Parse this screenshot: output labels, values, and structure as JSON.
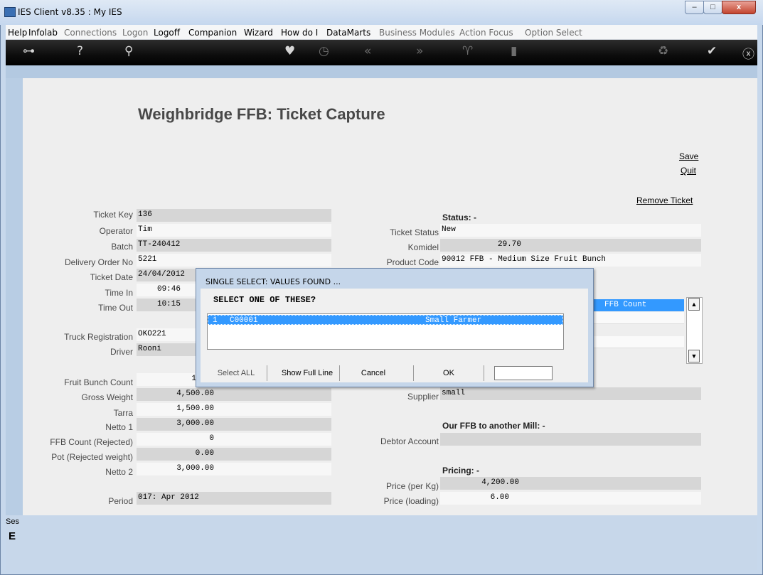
{
  "window": {
    "title": "IES Client v8.35 : My IES",
    "min": "–",
    "max": "□",
    "close": "x"
  },
  "menu": [
    {
      "label": "Help",
      "enabled": true
    },
    {
      "label": "Infolab",
      "enabled": true
    },
    {
      "label": "Connections",
      "enabled": false
    },
    {
      "label": "Logon",
      "enabled": false
    },
    {
      "label": "Logoff",
      "enabled": true
    },
    {
      "label": "Companion",
      "enabled": true
    },
    {
      "label": "Wizard",
      "enabled": true
    },
    {
      "label": "How do I",
      "enabled": true
    },
    {
      "label": "DataMarts",
      "enabled": true
    },
    {
      "label": "Business Modules",
      "enabled": false
    },
    {
      "label": "Action Focus",
      "enabled": false
    },
    {
      "label": "Option Select",
      "enabled": false
    }
  ],
  "toolbar": {
    "key": "⊶",
    "help": "?",
    "search": "⚲",
    "heart": "♥",
    "clock": "◷",
    "prev": "«",
    "next": "»",
    "tree": "♈",
    "doc": "▮",
    "recycle": "♻",
    "check": "✔",
    "close": "ⓧ"
  },
  "page": {
    "title": "Weighbridge FFB: Ticket Capture",
    "save": "Save",
    "quit": "Quit",
    "remove_ticket": "Remove Ticket"
  },
  "left": {
    "ticket_key": {
      "label": "Ticket Key",
      "value": "136"
    },
    "operator": {
      "label": "Operator",
      "value": "Tim"
    },
    "batch": {
      "label": "Batch",
      "value": "TT-240412"
    },
    "delivery_order": {
      "label": "Delivery Order No",
      "value": "5221"
    },
    "ticket_date": {
      "label": "Ticket Date",
      "value": "24/04/2012"
    },
    "time_in": {
      "label": "Time In",
      "value": "09:46"
    },
    "time_out": {
      "label": "Time Out",
      "value": "10:15"
    },
    "truck_reg": {
      "label": "Truck Registration",
      "value": "OKO221"
    },
    "driver": {
      "label": "Driver",
      "value": "Rooni"
    },
    "fruit_bunch_count": {
      "label": "Fruit Bunch Count",
      "value": "1"
    },
    "gross_weight": {
      "label": "Gross Weight",
      "value": "4,500.00"
    },
    "tarra": {
      "label": "Tarra",
      "value": "1,500.00"
    },
    "netto1": {
      "label": "Netto 1",
      "value": "3,000.00"
    },
    "ffb_rejected": {
      "label": "FFB Count (Rejected)",
      "value": "0"
    },
    "pot_rejected": {
      "label": "Pot (Rejected weight)",
      "value": "0.00"
    },
    "netto2": {
      "label": "Netto 2",
      "value": "3,000.00"
    },
    "period": {
      "label": "Period",
      "value": "017: Apr 2012"
    }
  },
  "right": {
    "status_heading": "Status: -",
    "ticket_status": {
      "label": "Ticket Status",
      "value": "New"
    },
    "komidel": {
      "label": "Komidel",
      "value": "29.70"
    },
    "product_code": {
      "label": "Product Code",
      "value": "90012 FFB - Medium Size Fruit Bunch"
    },
    "grid_header": "FFB Count",
    "supplier": {
      "label": "Supplier",
      "value": "small"
    },
    "mill_heading": "Our FFB to another Mill: -",
    "debtor_account": {
      "label": "Debtor Account",
      "value": ""
    },
    "pricing_heading": "Pricing: -",
    "price_kg": {
      "label": "Price (per Kg)",
      "value": "4,200.00"
    },
    "price_loading": {
      "label": "Price (loading)",
      "value": "6.00"
    }
  },
  "dialog": {
    "title": "SINGLE SELECT: VALUES FOUND ...",
    "prompt": "SELECT ONE OF THESE?",
    "row": {
      "index": "1",
      "code": "C00001",
      "name": "Small Farmer"
    },
    "buttons": {
      "select_all": "Select ALL",
      "show_full_line": "Show Full Line",
      "cancel": "Cancel",
      "ok": "OK"
    }
  },
  "bottom": {
    "ses": "Ses",
    "mark": "E"
  },
  "colors": {
    "selection": "#3399ff",
    "toolbar": "#000000",
    "panel": "#eeeeee"
  }
}
